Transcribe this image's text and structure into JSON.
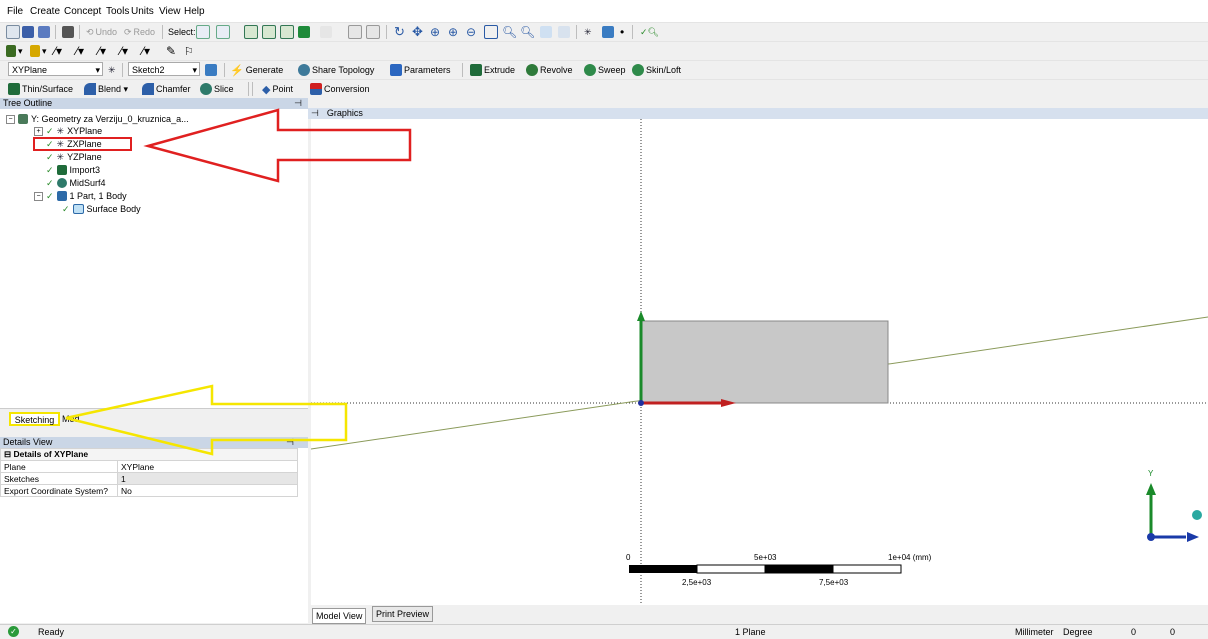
{
  "menu": [
    "File",
    "Create",
    "Concept",
    "Tools",
    "Units",
    "View",
    "Help"
  ],
  "toolbar1": {
    "undo": "Undo",
    "redo": "Redo",
    "select": "Select:"
  },
  "toolbar3": {
    "plane_select": "XYPlane",
    "sketch_select": "Sketch2",
    "generate": "Generate",
    "share_topology": "Share Topology",
    "parameters": "Parameters",
    "extrude": "Extrude",
    "revolve": "Revolve",
    "sweep": "Sweep",
    "skin_loft": "Skin/Loft"
  },
  "toolbar4": {
    "thin_surface": "Thin/Surface",
    "blend": "Blend ▾",
    "chamfer": "Chamfer",
    "slice": "Slice",
    "point": "Point",
    "conversion": "Conversion"
  },
  "tree_outline": {
    "title": "Tree Outline",
    "pin": "&#x4;",
    "items": [
      {
        "label": "Y: Geometry za Verziju_0_kruznica_a..."
      },
      {
        "label": "XYPlane"
      },
      {
        "label": "ZXPlane"
      },
      {
        "label": "YZPlane"
      },
      {
        "label": "Import3"
      },
      {
        "label": "MidSurf4"
      },
      {
        "label": "1 Part, 1 Body"
      },
      {
        "label": "Surface Body"
      }
    ]
  },
  "tabs": {
    "sketching": "Sketching",
    "modeling": "Mod"
  },
  "details": {
    "title": "Details View",
    "section": "Details of XYPlane",
    "rows": [
      {
        "key": "Plane",
        "value": "XYPlane"
      },
      {
        "key": "Sketches",
        "value": "1"
      },
      {
        "key": "Export Coordinate System?",
        "value": "No"
      }
    ]
  },
  "graphics": {
    "title": "Graphics",
    "scale": {
      "zero": "0",
      "mid": "5e+03",
      "end": "1e+04 (mm)",
      "q1": "2,5e+03",
      "q3": "7,5e+03"
    },
    "axis_y": "Y"
  },
  "view_tabs": {
    "model_view": "Model View",
    "print_preview": "Print Preview"
  },
  "status": {
    "ready": "Ready",
    "selection": "1 Plane",
    "units": "Millimeter",
    "angle": "Degree",
    "v1": "0",
    "v2": "0"
  },
  "colors": {
    "accent_red": "#e02020",
    "accent_yellow": "#f5e600",
    "header_blue": "#cad6e6",
    "body_fill": "#c8c8c8"
  }
}
